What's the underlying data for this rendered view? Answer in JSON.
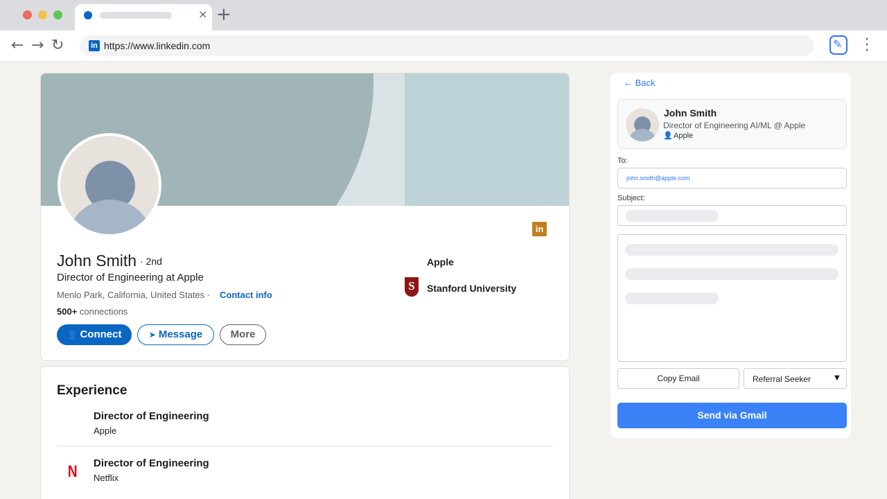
{
  "browser": {
    "url": "https://www.linkedin.com",
    "favicon_text": "in",
    "colors": {
      "close": "#ed6a5e",
      "minimize": "#f5bf4f",
      "maximize": "#61c554"
    },
    "icons": {
      "back": "←",
      "forward": "→",
      "reload": "↻",
      "close_tab": "×",
      "new_tab": "+",
      "menu": "⋮",
      "extension": "✎"
    }
  },
  "profile": {
    "name": "John Smith",
    "degree": "· 2nd",
    "headline": "Director of Engineering at Apple",
    "location": "Menlo Park, California, United States ·",
    "contact_info": "Contact info",
    "connections_count": "500+",
    "connections_label": "connections",
    "badge_text": "in",
    "buttons": {
      "connect": "Connect",
      "message": "Message",
      "more": "More"
    },
    "orgs": [
      {
        "name": "Apple",
        "icon": "apple-logo"
      },
      {
        "name": "Stanford University",
        "icon": "stanford-logo",
        "logo_letter": "S"
      }
    ]
  },
  "experience": {
    "title": "Experience",
    "items": [
      {
        "role": "Director of Engineering",
        "company": "Apple",
        "icon": "apple-logo"
      },
      {
        "role": "Director of Engineering",
        "company": "Netflix",
        "icon": "netflix-logo",
        "logo_letter": "N"
      }
    ]
  },
  "panel": {
    "back": "← Back",
    "person": {
      "name": "John Smith",
      "title": "Director of Engineering AI/ML @ Apple",
      "company": "Apple"
    },
    "to_label": "To:",
    "to_value": "john.smith@apple.com",
    "subject_label": "Subject:",
    "copy_email": "Copy Email",
    "template_select": "Referral Seeker",
    "send_button": "Send via Gmail",
    "accent_color": "#3b82f6"
  }
}
